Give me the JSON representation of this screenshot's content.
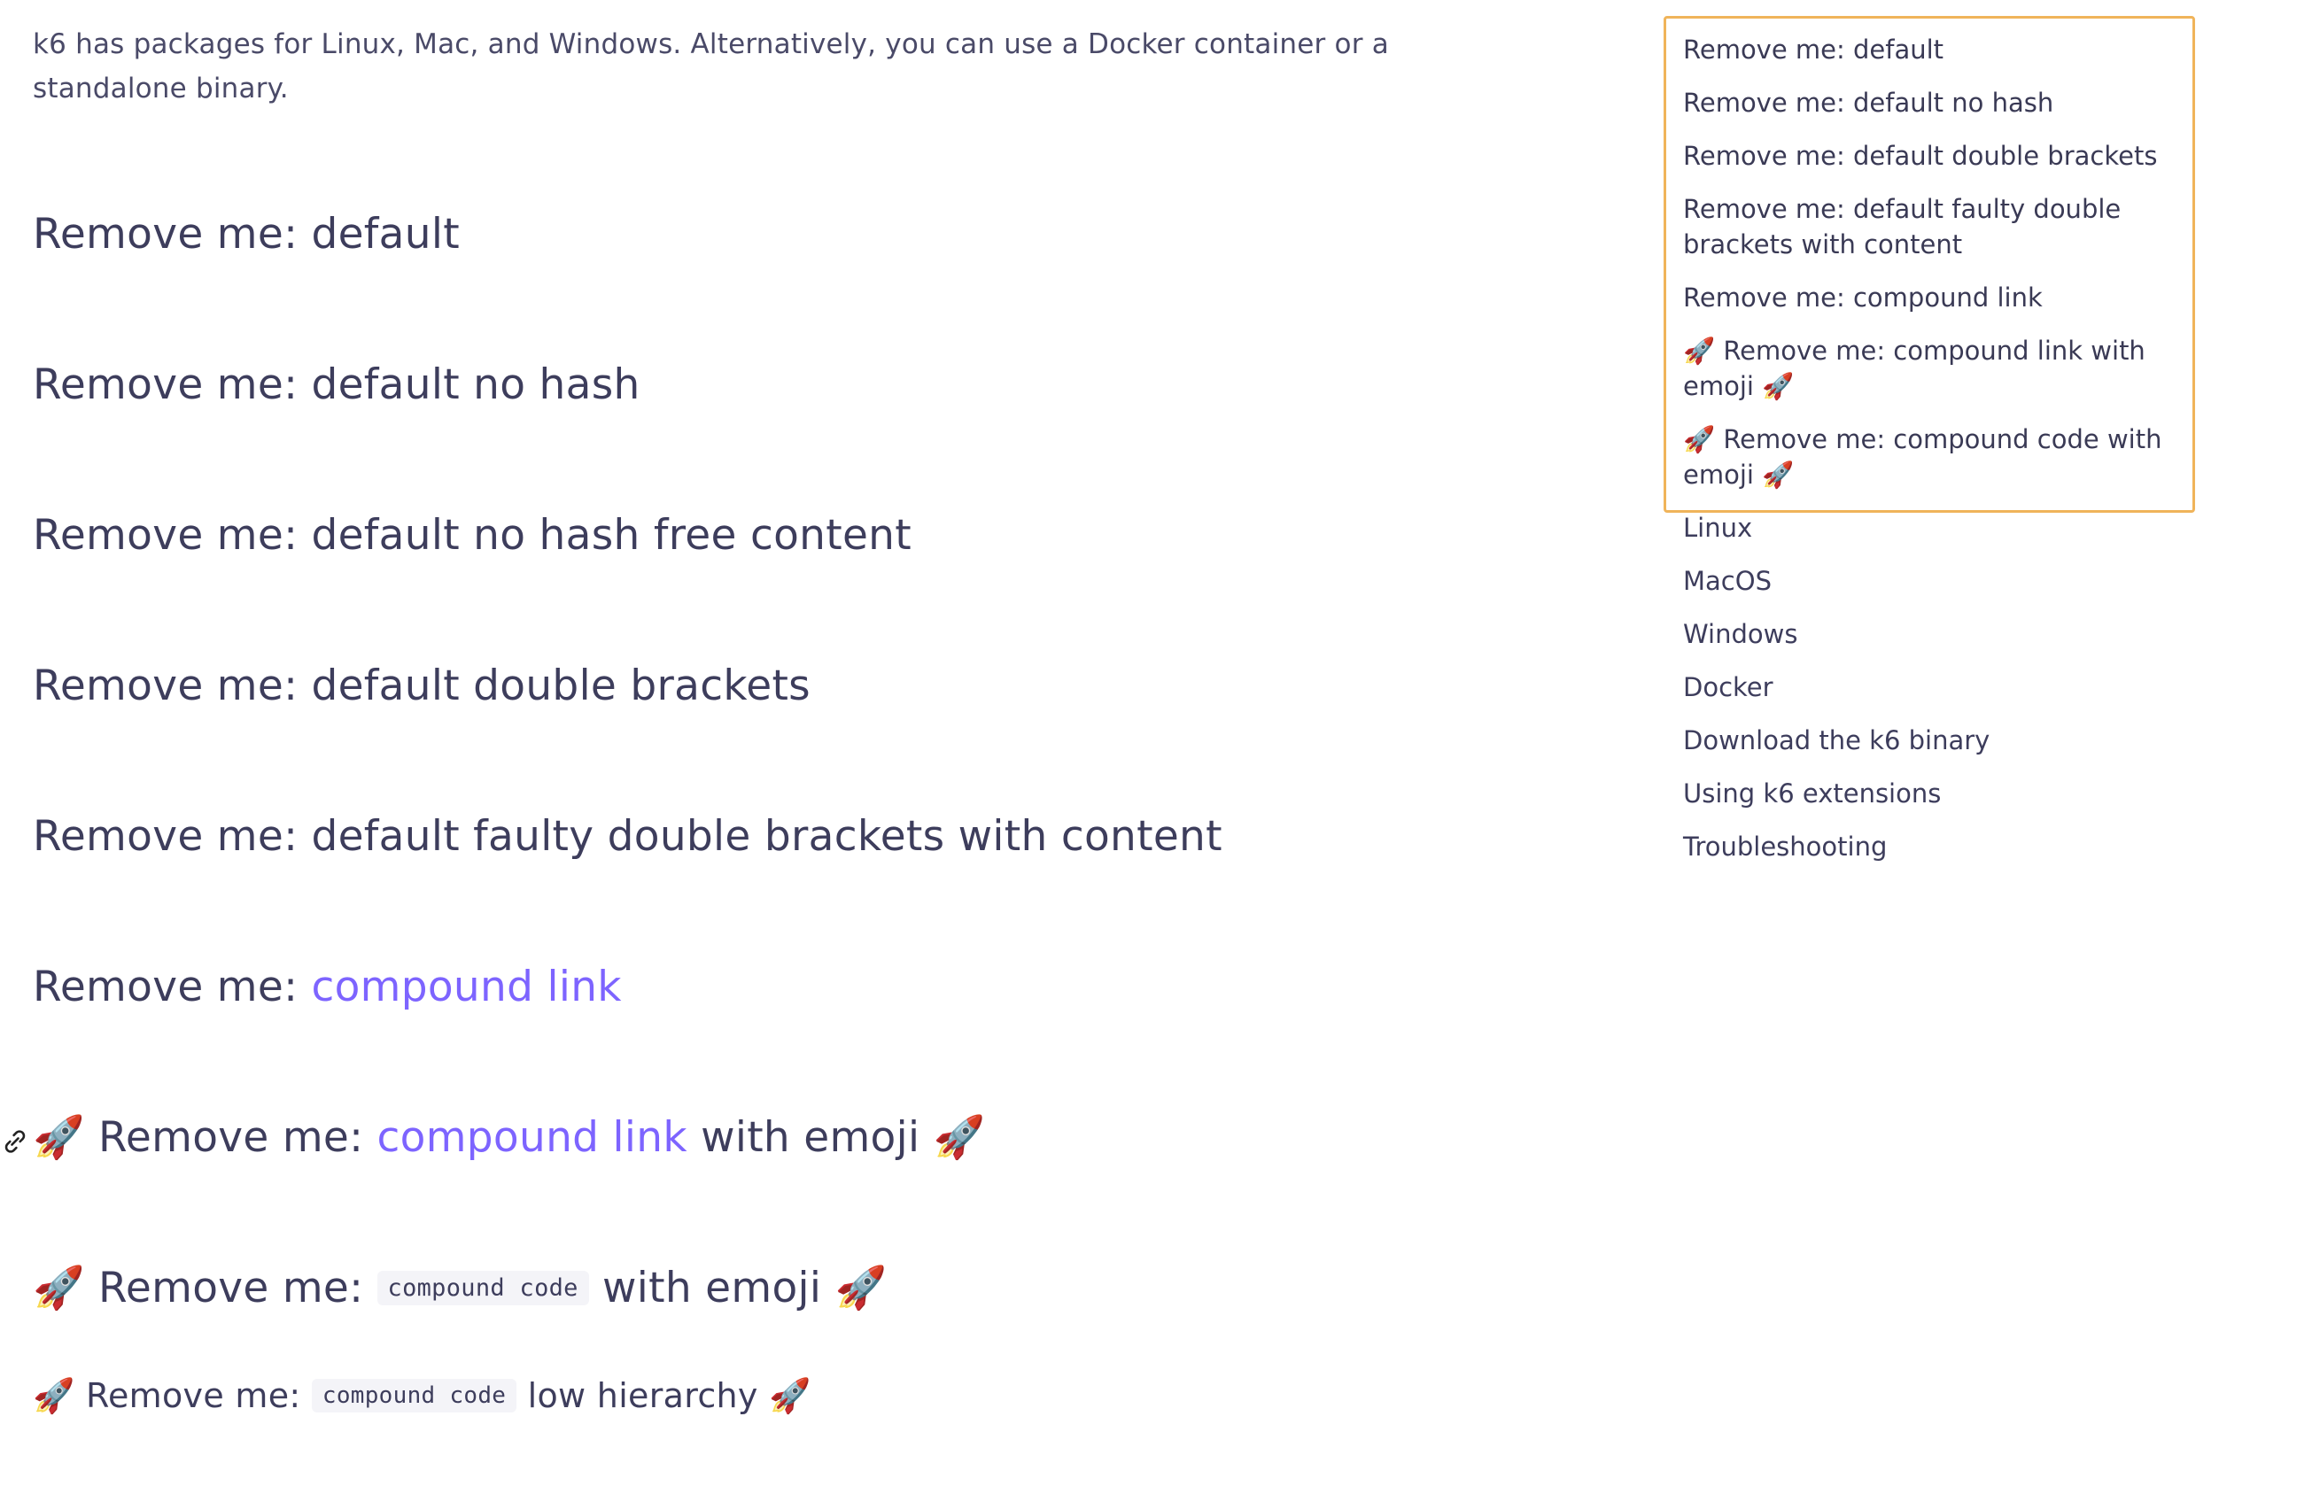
{
  "intro": "k6 has packages for Linux, Mac, and Windows. Alternatively, you can use a Docker container or a standalone binary.",
  "headings": {
    "h1": "Remove me: default",
    "h2": "Remove me: default no hash",
    "h3": "Remove me: default no hash free content",
    "h4": "Remove me: default double brackets",
    "h5": "Remove me: default faulty double brackets with content",
    "h6_prefix": "Remove me: ",
    "h6_link": "compound link",
    "h7_prefix": "🚀 Remove me: ",
    "h7_link": "compound link",
    "h7_suffix": " with emoji 🚀",
    "h8_prefix": "🚀 Remove me: ",
    "h8_code": "compound code",
    "h8_suffix": " with emoji 🚀",
    "h9_prefix": "🚀 Remove me: ",
    "h9_code": "compound code",
    "h9_suffix": " low hierarchy 🚀"
  },
  "toc": {
    "items": [
      "Remove me: default",
      "Remove me: default no hash",
      "Remove me: default double brackets",
      "Remove me: default faulty double brackets with content",
      "Remove me: compound link",
      "🚀 Remove me: compound link with emoji 🚀",
      "🚀 Remove me: compound code with emoji 🚀",
      "Linux",
      "MacOS",
      "Windows",
      "Docker",
      "Download the k6 binary",
      "Using k6 extensions",
      "Troubleshooting"
    ]
  },
  "colors": {
    "text": "#3d3d5c",
    "link": "#7d64ff",
    "toc_highlight_border": "#f0b45a",
    "code_bg": "#f4f4f8"
  },
  "icons": {
    "anchor": "link-icon"
  }
}
